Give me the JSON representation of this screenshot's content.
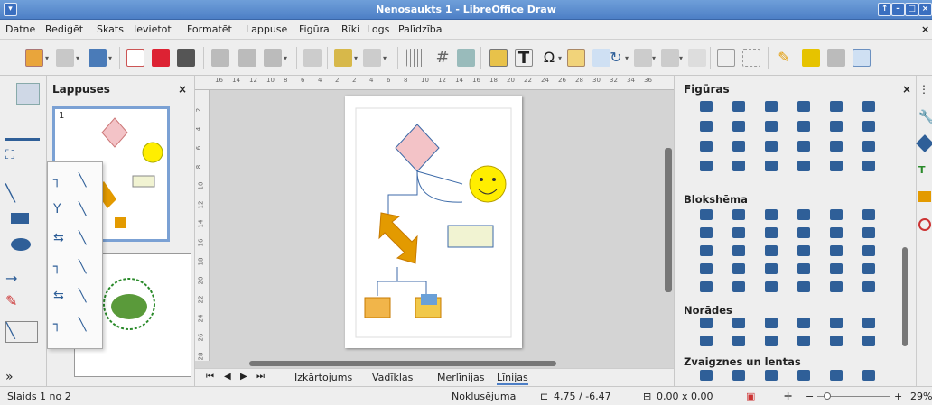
{
  "window": {
    "title": "Nenosaukts 1 - LibreOffice Draw",
    "btn_up": "↑",
    "btn_min": "–",
    "btn_max": "□",
    "btn_close": "×"
  },
  "menu": [
    "Datne",
    "Rediģēt",
    "Skats",
    "Ievietot",
    "Formatēt",
    "Lappuse",
    "Figūra",
    "Rīki",
    "Logs",
    "Palīdzība"
  ],
  "menu_close": "×",
  "pages_panel": {
    "title": "Lappuses",
    "close": "×",
    "page1_num": "1",
    "expand": "»"
  },
  "ruler": {
    "ticks": [
      "16",
      "14",
      "12",
      "10",
      "8",
      "6",
      "4",
      "2",
      "2",
      "4",
      "6",
      "8",
      "10",
      "12",
      "14",
      "16",
      "18",
      "20",
      "22",
      "24",
      "26",
      "28",
      "30",
      "32",
      "34",
      "36"
    ],
    "vticks": [
      "2",
      "4",
      "6",
      "8",
      "10",
      "12",
      "14",
      "16",
      "18",
      "20",
      "22",
      "24",
      "26",
      "28"
    ]
  },
  "tabs": [
    "Izkārtojums",
    "Vadīklas",
    "Merlīnijas",
    "Līnijas"
  ],
  "tab_active": "Līnijas",
  "tab_nav": [
    "⏮",
    "◀",
    "▶",
    "⏭"
  ],
  "shapes_panel": {
    "title": "Figūras",
    "close": "×",
    "menu": "⋮",
    "sections": [
      "Blokshēma",
      "Norādes",
      "Zvaigznes un lentas"
    ]
  },
  "status": {
    "slide": "Slaids 1 no 2",
    "layout": "Noklusējuma",
    "position": "4,75 / -6,47",
    "size": "0,00 x 0,00",
    "zoom": "29%",
    "zoom_minus": "−",
    "zoom_plus": "+"
  },
  "colors": {
    "accent": "#4d7fc6",
    "shape_blue": "#2f5f98",
    "diamond": "#f3c3c7",
    "smiley": "#ffee00",
    "folder": "#e39a00",
    "rect": "#f1f3d2"
  }
}
